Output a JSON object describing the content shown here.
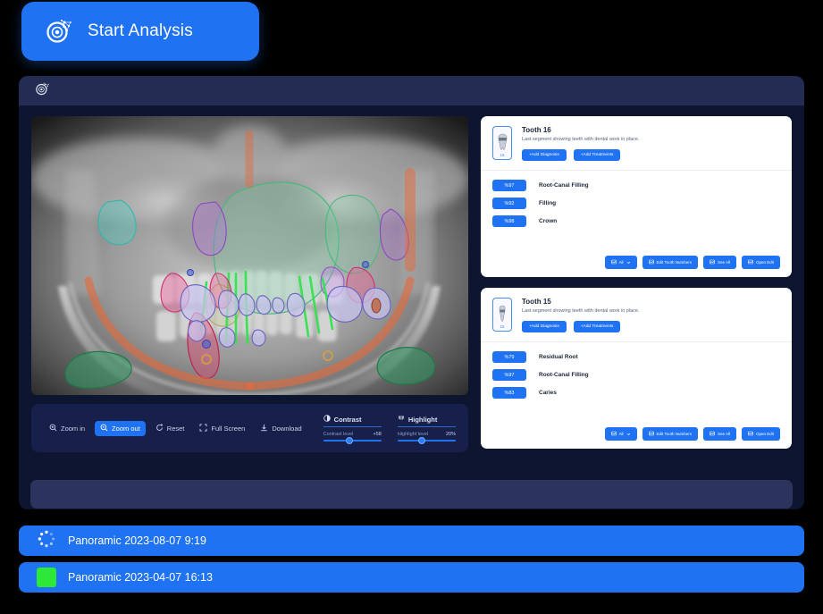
{
  "start_button": {
    "label": "Start Analysis",
    "icon": "orbit-logo-icon",
    "color": "#1f72f2"
  },
  "app": {
    "header": {
      "logo_icon": "orbit-logo-icon",
      "bg": "#232c52"
    },
    "background": "#0d1530"
  },
  "viewer": {
    "image_type": "panoramic-dental-xray",
    "overlay_legend": [
      "green",
      "purple",
      "pink",
      "teal",
      "orange",
      "lavender"
    ]
  },
  "toolbar": {
    "buttons": [
      {
        "label": "Zoom in",
        "icon": "zoom-in-icon",
        "active": false
      },
      {
        "label": "Zoom out",
        "icon": "zoom-out-icon",
        "active": true
      },
      {
        "label": "Reset",
        "icon": "reset-icon",
        "active": false
      },
      {
        "label": "Full Screen",
        "icon": "fullscreen-icon",
        "active": false
      },
      {
        "label": "Download",
        "icon": "download-icon",
        "active": false
      }
    ],
    "contrast": {
      "title": "Contrast",
      "icon": "contrast-icon",
      "row_label": "Contrast level",
      "value": "+58",
      "knob_percent": 45
    },
    "highlight": {
      "title": "Highlight",
      "icon": "highlight-icon",
      "row_label": "Highlight level",
      "value": "20%",
      "knob_percent": 42
    }
  },
  "cards": [
    {
      "thumb_number": "16",
      "title": "Tooth 16",
      "subtitle": "Last segment showing teeth with dental work in place.",
      "chips": [
        {
          "label": "+Add Diagnosis"
        },
        {
          "label": "+Add Treatments"
        }
      ],
      "findings": [
        {
          "score": "%97",
          "label": "Root-Canal Filling"
        },
        {
          "score": "%92",
          "label": "Filling"
        },
        {
          "score": "%98",
          "label": "Crown"
        }
      ],
      "footer_buttons": [
        {
          "label": "All",
          "icon": "image-icon",
          "caret": true
        },
        {
          "label": "Edit Tooth Numbers",
          "icon": "image-icon",
          "caret": false
        },
        {
          "label": "See All",
          "icon": "image-icon",
          "caret": false
        },
        {
          "label": "Open Edit",
          "icon": "image-icon",
          "caret": false
        }
      ]
    },
    {
      "thumb_number": "15",
      "title": "Tooth 15",
      "subtitle": "Last segment showing teeth with dental work in place.",
      "chips": [
        {
          "label": "+Add Diagnosis"
        },
        {
          "label": "+Add Treatments"
        }
      ],
      "findings": [
        {
          "score": "%79",
          "label": "Residual Root"
        },
        {
          "score": "%97",
          "label": "Root-Canal Filling"
        },
        {
          "score": "%83",
          "label": "Caries"
        }
      ],
      "footer_buttons": [
        {
          "label": "All",
          "icon": "image-icon",
          "caret": true
        },
        {
          "label": "Edit Tooth Numbers",
          "icon": "image-icon",
          "caret": false
        },
        {
          "label": "See All",
          "icon": "image-icon",
          "caret": false
        },
        {
          "label": "Open Edit",
          "icon": "image-icon",
          "caret": false
        }
      ]
    }
  ],
  "file_list": [
    {
      "label": "Panoramic 2023-08-07 9:19",
      "status_icon": "loading-spinner-icon"
    },
    {
      "label": "Panoramic 2023-04-07 16:13",
      "status_icon": "green-square-icon"
    }
  ]
}
